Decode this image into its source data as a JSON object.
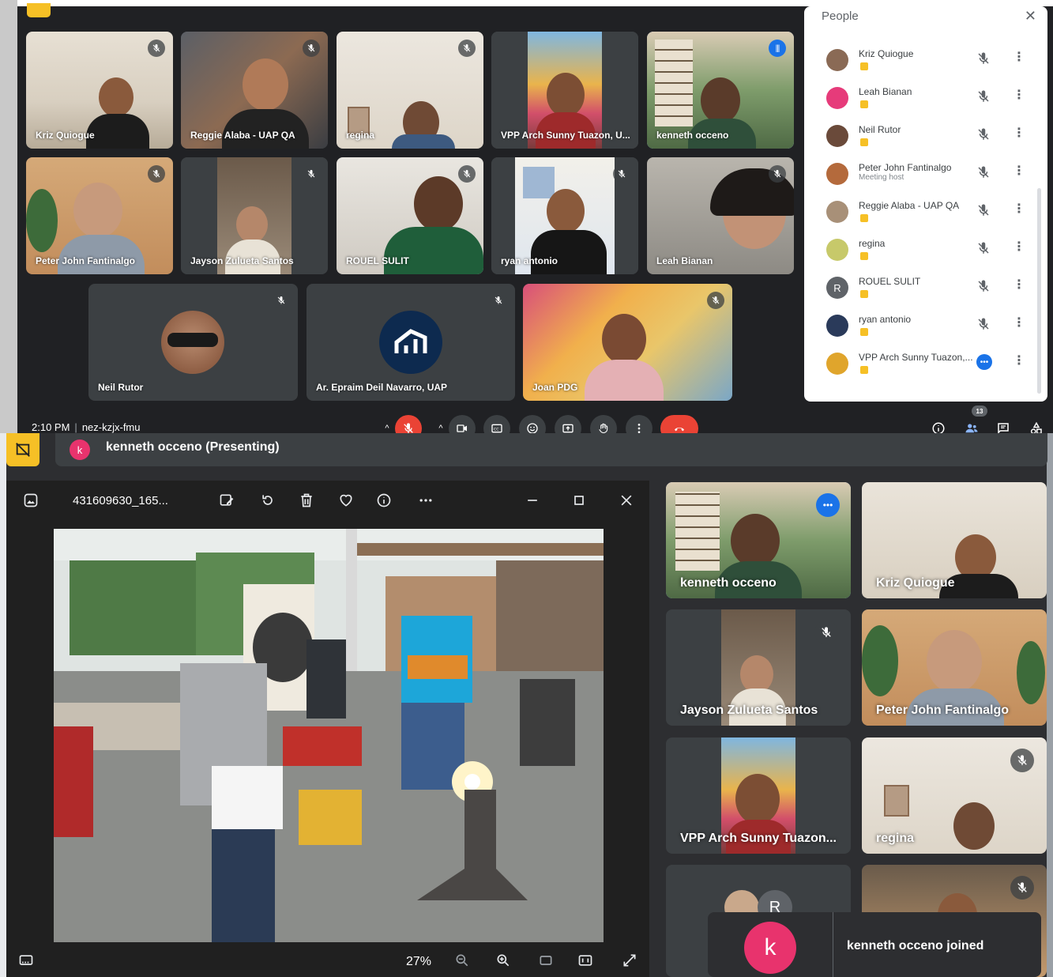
{
  "top_meeting": {
    "tiles": [
      {
        "name": "Kriz Quiogue",
        "muted": true
      },
      {
        "name": "Reggie Alaba - UAP QA",
        "muted": true
      },
      {
        "name": "regina",
        "muted": true
      },
      {
        "name": "VPP Arch Sunny Tuazon, U...",
        "muted": false
      },
      {
        "name": "kenneth occeno",
        "muted": false,
        "speaking": true
      },
      {
        "name": "Peter John Fantinalgo",
        "muted": true
      },
      {
        "name": "Jayson Zulueta Santos",
        "muted": true
      },
      {
        "name": "ROUEL SULIT",
        "muted": true
      },
      {
        "name": "ryan antonio",
        "muted": true
      },
      {
        "name": "Leah Bianan",
        "muted": true
      },
      {
        "name": "Neil Rutor",
        "muted": true
      },
      {
        "name": "Ar. Epraim Deil Navarro, UAP",
        "muted": true
      },
      {
        "name": "Joan PDG",
        "muted": true
      }
    ],
    "people_panel": {
      "title": "People",
      "close_icon": "close-icon",
      "participants": [
        {
          "name": "Kriz Quiogue",
          "role": ""
        },
        {
          "name": "Leah Bianan",
          "role": ""
        },
        {
          "name": "Neil Rutor",
          "role": ""
        },
        {
          "name": "Peter John Fantinalgo",
          "role": "Meeting host"
        },
        {
          "name": "Reggie Alaba - UAP QA",
          "role": ""
        },
        {
          "name": "regina",
          "role": ""
        },
        {
          "name": "ROUEL SULIT",
          "role": "",
          "initial": "R"
        },
        {
          "name": "ryan antonio",
          "role": ""
        },
        {
          "name": "VPP Arch Sunny Tuazon,...",
          "role": ""
        }
      ]
    },
    "bottom_bar": {
      "time": "2:10 PM",
      "separator": "|",
      "meeting_code": "nez-kzjx-fmu",
      "people_count": "13"
    },
    "colors": {
      "bg": "#202124",
      "hangup": "#ea4335",
      "speaking": "#8ab4f8",
      "accent": "#1a73e8"
    }
  },
  "presenting": {
    "header": {
      "avatar_initial": "k",
      "text": "kenneth occeno (Presenting)"
    },
    "viewer": {
      "file_name": "431609630_165...",
      "zoom": "27%"
    },
    "tiles": [
      {
        "name": "kenneth occeno",
        "speaking": true
      },
      {
        "name": "Kriz Quiogue"
      },
      {
        "name": "Jayson Zulueta Santos",
        "muted": true
      },
      {
        "name": "Peter John Fantinalgo"
      },
      {
        "name": "VPP Arch Sunny Tuazon..."
      },
      {
        "name": "regina",
        "muted": true
      }
    ],
    "more_avatar_initial": "R",
    "toast": {
      "initial": "k",
      "text": "kenneth occeno joined"
    }
  }
}
